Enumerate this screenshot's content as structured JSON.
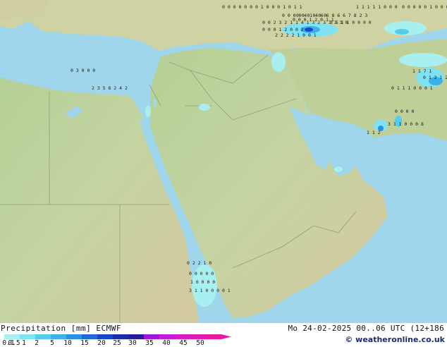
{
  "footer": {
    "title_left": "Precipitation [mm] ECMWF",
    "title_right": "Mo 24-02-2025 00..06 UTC (12+186",
    "credit": "© weatheronline.co.uk"
  },
  "legend": {
    "labels": [
      "0.1",
      "0.5",
      "1",
      "2",
      "5",
      "10",
      "15",
      "20",
      "25",
      "30",
      "35",
      "40",
      "45",
      "50"
    ],
    "colors": [
      "#a8f0f0",
      "#7fe2f2",
      "#55ccee",
      "#3db0ea",
      "#2a90e0",
      "#1e6ad6",
      "#1a48c4",
      "#1a2ea8",
      "#2a1e96",
      "#9e18d6",
      "#c21cd8",
      "#d81cc8",
      "#e01ab6",
      "#e81aa4"
    ]
  },
  "map": {
    "sea_color": "#9fd6ec",
    "land_color": "#a9c98c",
    "precip_digits": [
      "0 0 0 0 0 0 0 1 0 0 0 1 0 1 1",
      "1 1 1 1 1 0 0 0",
      "0 0 0 0 0 1 0 0 0 1 0 0",
      "0 0 0 0 4 1 4 6 6 8 6 6 7 8 2 3",
      "0 0 2 3 2 1 1 4 1 3 2 3 3 3 3 0",
      "3 5 1 1 0 0 0 0",
      "0 0 0 0 0 0",
      "0 0 0 1 2 0 1 1",
      "0 0 0 1 2 0 0 2",
      "2 2 2 2 1 0 0 1",
      "0 3 0 0 0",
      "2 3 5 6 2 4 2",
      "1 1 7 1",
      "0 1 2 1 2 3",
      "3 1 1 0 0 0 8",
      "1 1 2",
      "0 2 2 1 0",
      "0 0 0 0 0",
      "1 0 0 0 0",
      "3 1 1 0 0 0 0 1",
      "0 0 0 0",
      "0 1 1 1 0 0 0 1"
    ]
  }
}
